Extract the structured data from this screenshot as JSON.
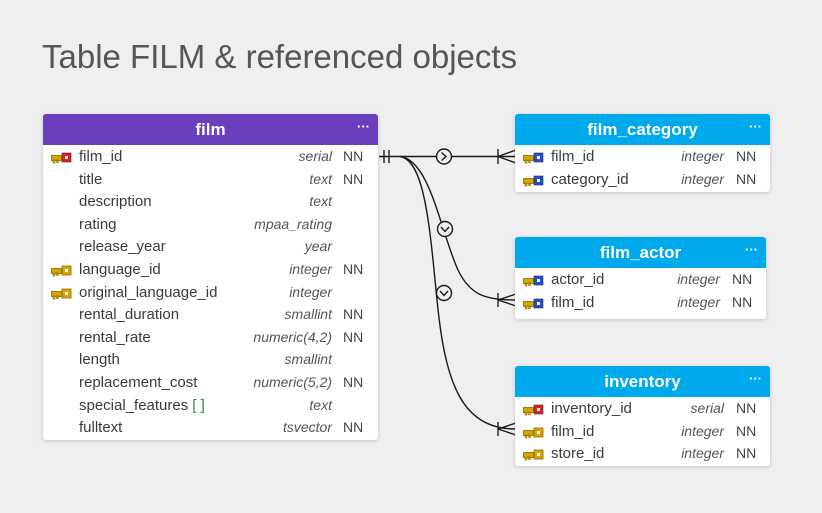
{
  "title": "Table FILM & referenced objects",
  "colors": {
    "film_header": "#6a3fbd",
    "ref_header": "#00a8ec",
    "background": "#efeff1"
  },
  "icons": {
    "pk": "primary-key-icon",
    "fk": "foreign-key-icon",
    "pk_fk": "primary-foreign-key-icon"
  },
  "tables": {
    "film": {
      "name": "film",
      "menu": "···",
      "columns": [
        {
          "name": "film_id",
          "type": "serial",
          "nn": "NN",
          "key": "pk"
        },
        {
          "name": "title",
          "type": "text",
          "nn": "NN",
          "key": ""
        },
        {
          "name": "description",
          "type": "text",
          "nn": "",
          "key": ""
        },
        {
          "name": "rating",
          "type": "mpaa_rating",
          "nn": "",
          "key": ""
        },
        {
          "name": "release_year",
          "type": "year",
          "nn": "",
          "key": ""
        },
        {
          "name": "language_id",
          "type": "integer",
          "nn": "NN",
          "key": "fk"
        },
        {
          "name": "original_language_id",
          "type": "integer",
          "nn": "",
          "key": "fk"
        },
        {
          "name": "rental_duration",
          "type": "smallint",
          "nn": "NN",
          "key": ""
        },
        {
          "name": "rental_rate",
          "type": "numeric(4,2)",
          "nn": "NN",
          "key": ""
        },
        {
          "name": "length",
          "type": "smallint",
          "nn": "",
          "key": ""
        },
        {
          "name": "replacement_cost",
          "type": "numeric(5,2)",
          "nn": "NN",
          "key": ""
        },
        {
          "name": "special_features",
          "array": "[ ]",
          "type": "text",
          "nn": "",
          "key": ""
        },
        {
          "name": "fulltext",
          "type": "tsvector",
          "nn": "NN",
          "key": ""
        }
      ]
    },
    "film_category": {
      "name": "film_category",
      "menu": "···",
      "columns": [
        {
          "name": "film_id",
          "type": "integer",
          "nn": "NN",
          "key": "pk_fk"
        },
        {
          "name": "category_id",
          "type": "integer",
          "nn": "NN",
          "key": "pk_fk"
        }
      ]
    },
    "film_actor": {
      "name": "film_actor",
      "menu": "···",
      "columns": [
        {
          "name": "actor_id",
          "type": "integer",
          "nn": "NN",
          "key": "pk_fk"
        },
        {
          "name": "film_id",
          "type": "integer",
          "nn": "NN",
          "key": "pk_fk"
        }
      ]
    },
    "inventory": {
      "name": "inventory",
      "menu": "···",
      "columns": [
        {
          "name": "inventory_id",
          "type": "serial",
          "nn": "NN",
          "key": "pk"
        },
        {
          "name": "film_id",
          "type": "integer",
          "nn": "NN",
          "key": "fk"
        },
        {
          "name": "store_id",
          "type": "integer",
          "nn": "NN",
          "key": "fk"
        }
      ]
    }
  }
}
